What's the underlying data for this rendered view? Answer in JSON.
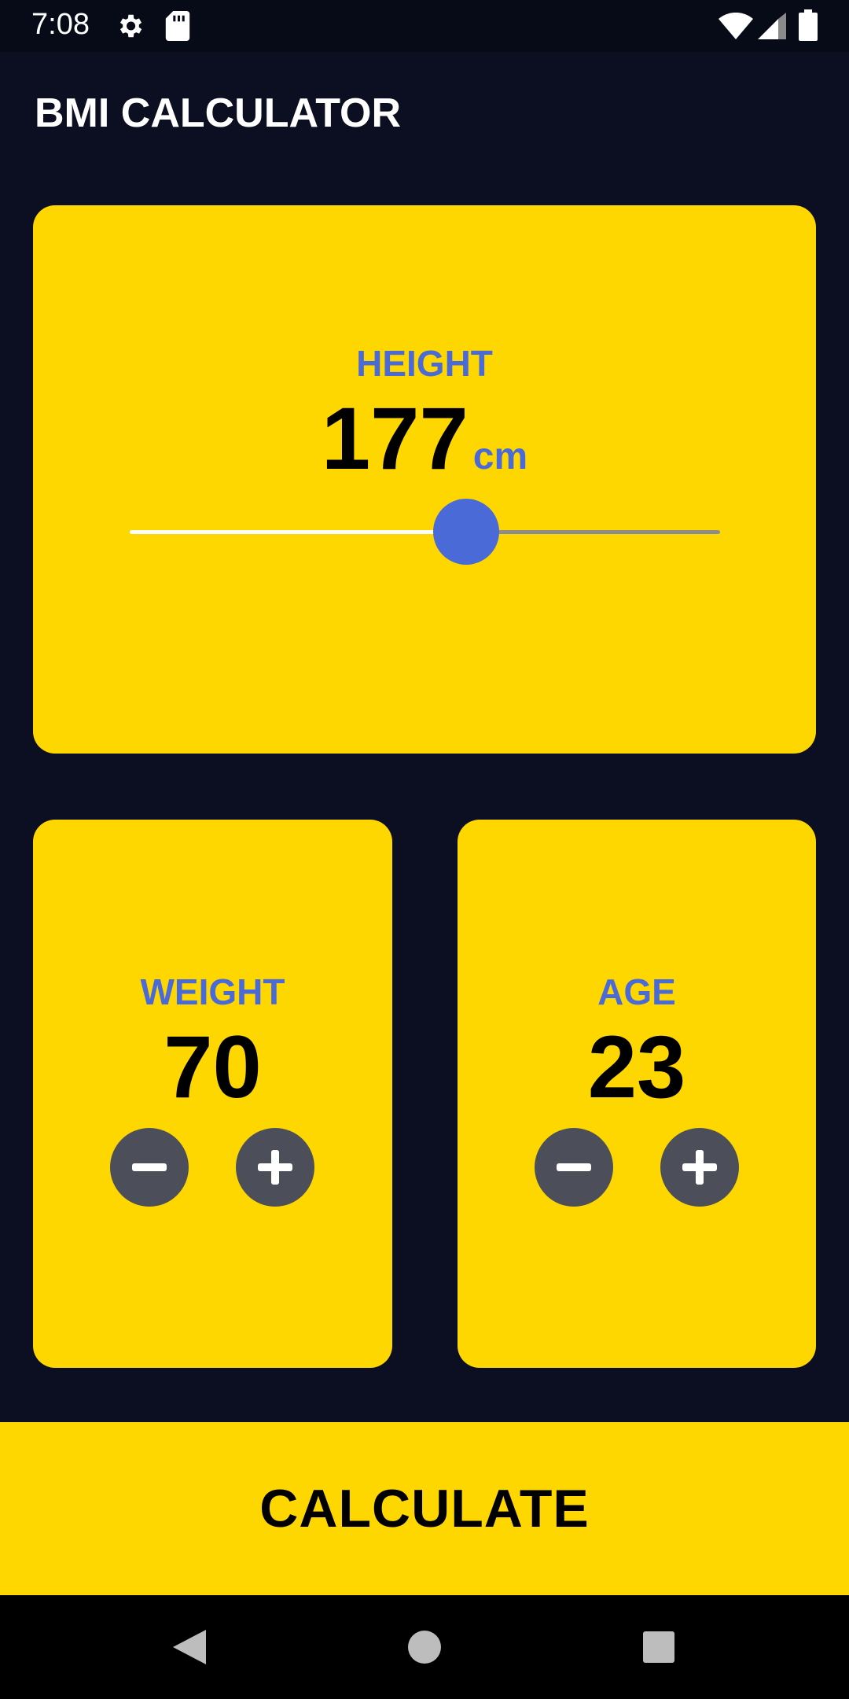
{
  "status_bar": {
    "time": "7:08",
    "icons": [
      "settings-icon",
      "sd-card-icon",
      "wifi-icon",
      "signal-icon",
      "battery-icon"
    ]
  },
  "app_bar": {
    "title": "BMI CALCULATOR"
  },
  "height_card": {
    "label": "HEIGHT",
    "value": "177",
    "unit": "cm",
    "slider_fraction": 0.57
  },
  "weight_card": {
    "label": "WEIGHT",
    "value": "70",
    "minus_icon": "minus-icon",
    "plus_icon": "plus-icon"
  },
  "age_card": {
    "label": "AGE",
    "value": "23",
    "minus_icon": "minus-icon",
    "plus_icon": "plus-icon"
  },
  "calculate_button": {
    "label": "CALCULATE"
  },
  "nav_bar": {
    "icons": [
      "back-icon",
      "home-icon",
      "recents-icon"
    ]
  },
  "colors": {
    "background": "#0b0f21",
    "card": "#fed700",
    "accent": "#4a6ad8",
    "round_button": "#4c4f5a"
  }
}
